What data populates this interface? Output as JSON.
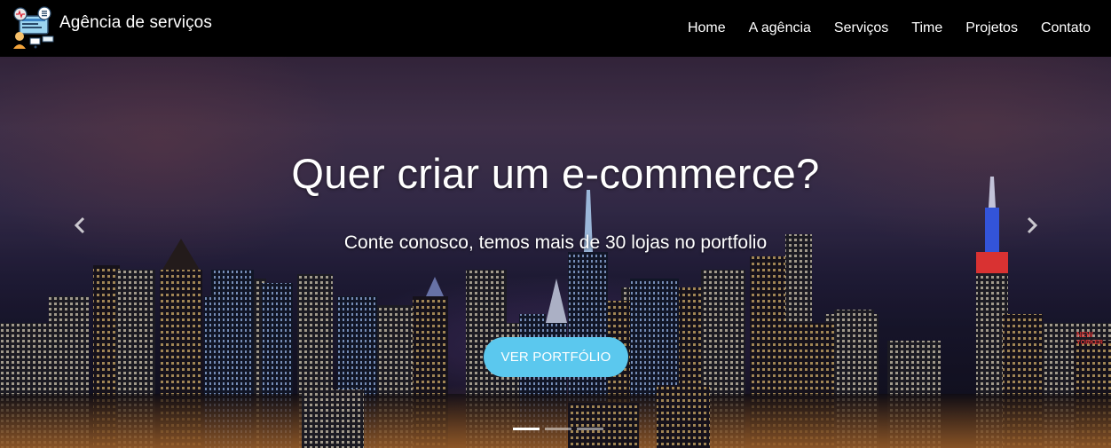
{
  "navbar": {
    "brand_title": "Agência de serviços",
    "logo_icon": "service-agency-logo-icon",
    "links": [
      {
        "label": "Home"
      },
      {
        "label": "A agência"
      },
      {
        "label": "Serviços"
      },
      {
        "label": "Time"
      },
      {
        "label": "Projetos"
      },
      {
        "label": "Contato"
      }
    ]
  },
  "hero": {
    "title": "Quer criar um e-commerce?",
    "subtitle": "Conte conosco, temos mais de 30 lojas no portfolio",
    "button_label": "VER PORTFÓLIO",
    "button_color": "#5bc8ee",
    "prev_icon": "chevron-left-icon",
    "next_icon": "chevron-right-icon",
    "background_image": "city skyline at night",
    "slides": 3,
    "active_slide": 1
  }
}
